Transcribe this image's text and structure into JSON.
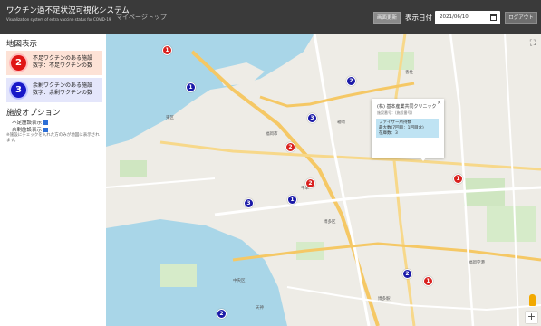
{
  "header": {
    "title": "ワクチン過不足状況可視化システム",
    "subtitle": "Visualization system of extra vaccine status for COVID-19",
    "mypage": "マイページトップ",
    "update_button": "画面更新",
    "date_label": "表示日付",
    "date_value": "2021/06/10",
    "logout_button": "ログアウト"
  },
  "sidebar": {
    "map_title": "地図表示",
    "legend": [
      {
        "number": "2",
        "line1": "不足ワクチンのある施設",
        "line2": "数字：不足ワクチンの数",
        "color": "#e01515"
      },
      {
        "number": "3",
        "line1": "余剰ワクチンのある施設",
        "line2": "数字：余剰ワクチンの数",
        "color": "#1818c8"
      }
    ],
    "options_title": "施設オプション",
    "options": [
      "不足施設表示",
      "余剰施設表示"
    ],
    "note": "※施設にチェックを入れた方のみが地図に表示されます。"
  },
  "map": {
    "popup": {
      "title": "(株) 基本産業共同クリニック",
      "sub": "施設番号：(施設番号)",
      "line1": "ファイザー所持数",
      "line2": "最大数(7回目：1回目含)",
      "line3": "在庫数：3"
    },
    "labels": [
      "東区",
      "福岡市",
      "博多区",
      "中央区",
      "福岡空港",
      "香椎",
      "箱崎",
      "千早",
      "天神",
      "博多駅"
    ],
    "markers": [
      {
        "type": "red",
        "value": "1"
      },
      {
        "type": "blue",
        "value": "1"
      },
      {
        "type": "blue",
        "value": "2"
      },
      {
        "type": "blue",
        "value": "3"
      },
      {
        "type": "red",
        "value": "2"
      },
      {
        "type": "red",
        "value": "2"
      },
      {
        "type": "blue",
        "value": "1"
      },
      {
        "type": "blue",
        "value": "3"
      },
      {
        "type": "blue",
        "value": "3"
      },
      {
        "type": "red",
        "value": "1"
      },
      {
        "type": "blue",
        "value": "2"
      },
      {
        "type": "red",
        "value": "1"
      },
      {
        "type": "blue",
        "value": "2"
      }
    ],
    "zoom_in": "+",
    "fullscreen": "⛶"
  }
}
